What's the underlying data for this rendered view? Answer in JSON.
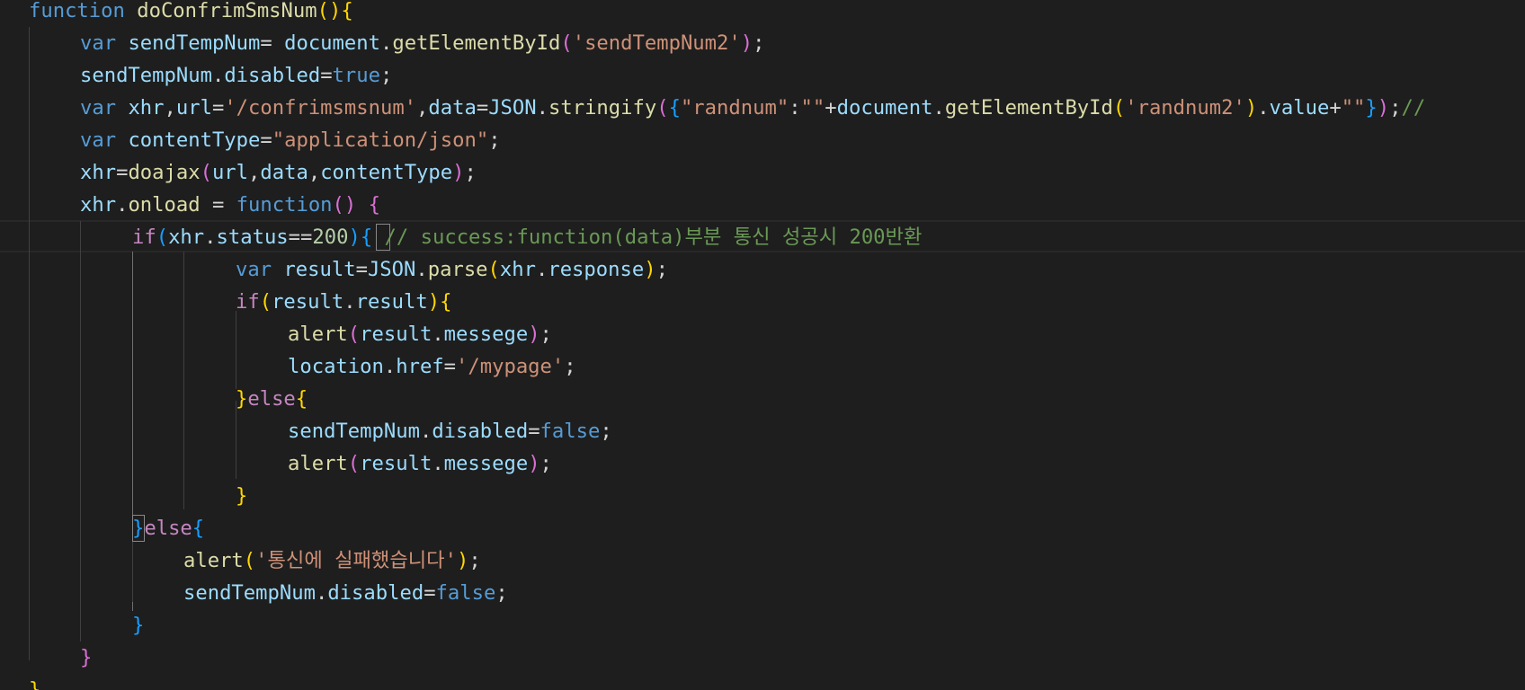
{
  "editor": {
    "language": "javascript",
    "theme_colors": {
      "background": "#1e1e1e",
      "keyword": "#569cd6",
      "control": "#c586c0",
      "function": "#dcdcaa",
      "variable": "#9cdcfe",
      "string": "#ce9178",
      "number": "#b5cea8",
      "comment": "#6a9955",
      "bracket_level_1": "#ffd700",
      "bracket_level_2": "#da70d6",
      "bracket_level_3": "#179fff"
    },
    "lines": [
      {
        "tokens": [
          {
            "t": "function",
            "c": "kw"
          },
          {
            "t": " ",
            "c": "pun"
          },
          {
            "t": "doConfrimSmsNum",
            "c": "fn"
          },
          {
            "t": "()",
            "c": "b1"
          },
          {
            "t": "{",
            "c": "b1"
          }
        ]
      },
      {
        "tokens": [
          {
            "t": "var",
            "c": "kw"
          },
          {
            "t": " ",
            "c": "pun"
          },
          {
            "t": "sendTempNum",
            "c": "var"
          },
          {
            "t": "= ",
            "c": "pun"
          },
          {
            "t": "document",
            "c": "var"
          },
          {
            "t": ".",
            "c": "pun"
          },
          {
            "t": "getElementById",
            "c": "fn"
          },
          {
            "t": "(",
            "c": "b2"
          },
          {
            "t": "'sendTempNum2'",
            "c": "str"
          },
          {
            "t": ")",
            "c": "b2"
          },
          {
            "t": ";",
            "c": "pun"
          }
        ]
      },
      {
        "tokens": [
          {
            "t": "sendTempNum",
            "c": "var"
          },
          {
            "t": ".",
            "c": "pun"
          },
          {
            "t": "disabled",
            "c": "var"
          },
          {
            "t": "=",
            "c": "pun"
          },
          {
            "t": "true",
            "c": "kw"
          },
          {
            "t": ";",
            "c": "pun"
          }
        ]
      },
      {
        "tokens": [
          {
            "t": "var",
            "c": "kw"
          },
          {
            "t": " ",
            "c": "pun"
          },
          {
            "t": "xhr",
            "c": "var"
          },
          {
            "t": ",",
            "c": "pun"
          },
          {
            "t": "url",
            "c": "var"
          },
          {
            "t": "=",
            "c": "pun"
          },
          {
            "t": "'/confrimsmsnum'",
            "c": "str"
          },
          {
            "t": ",",
            "c": "pun"
          },
          {
            "t": "data",
            "c": "var"
          },
          {
            "t": "=",
            "c": "pun"
          },
          {
            "t": "JSON",
            "c": "var"
          },
          {
            "t": ".",
            "c": "pun"
          },
          {
            "t": "stringify",
            "c": "fn"
          },
          {
            "t": "(",
            "c": "b2"
          },
          {
            "t": "{",
            "c": "b3"
          },
          {
            "t": "\"randnum\"",
            "c": "str"
          },
          {
            "t": ":",
            "c": "pun"
          },
          {
            "t": "\"\"",
            "c": "str"
          },
          {
            "t": "+",
            "c": "pun"
          },
          {
            "t": "document",
            "c": "var"
          },
          {
            "t": ".",
            "c": "pun"
          },
          {
            "t": "getElementById",
            "c": "fn"
          },
          {
            "t": "(",
            "c": "b1"
          },
          {
            "t": "'randnum2'",
            "c": "str"
          },
          {
            "t": ")",
            "c": "b1"
          },
          {
            "t": ".",
            "c": "pun"
          },
          {
            "t": "value",
            "c": "var"
          },
          {
            "t": "+",
            "c": "pun"
          },
          {
            "t": "\"\"",
            "c": "str"
          },
          {
            "t": "}",
            "c": "b3"
          },
          {
            "t": ")",
            "c": "b2"
          },
          {
            "t": ";",
            "c": "pun"
          },
          {
            "t": "//",
            "c": "com"
          }
        ]
      },
      {
        "tokens": [
          {
            "t": "var",
            "c": "kw"
          },
          {
            "t": " ",
            "c": "pun"
          },
          {
            "t": "contentType",
            "c": "var"
          },
          {
            "t": "=",
            "c": "pun"
          },
          {
            "t": "\"application/json\"",
            "c": "str"
          },
          {
            "t": ";",
            "c": "pun"
          }
        ]
      },
      {
        "tokens": [
          {
            "t": "xhr",
            "c": "var"
          },
          {
            "t": "=",
            "c": "pun"
          },
          {
            "t": "doajax",
            "c": "fn"
          },
          {
            "t": "(",
            "c": "b2"
          },
          {
            "t": "url",
            "c": "var"
          },
          {
            "t": ",",
            "c": "pun"
          },
          {
            "t": "data",
            "c": "var"
          },
          {
            "t": ",",
            "c": "pun"
          },
          {
            "t": "contentType",
            "c": "var"
          },
          {
            "t": ")",
            "c": "b2"
          },
          {
            "t": ";",
            "c": "pun"
          }
        ]
      },
      {
        "tokens": [
          {
            "t": "xhr",
            "c": "var"
          },
          {
            "t": ".",
            "c": "pun"
          },
          {
            "t": "onload",
            "c": "fn"
          },
          {
            "t": " = ",
            "c": "pun"
          },
          {
            "t": "function",
            "c": "kw"
          },
          {
            "t": "()",
            "c": "b2"
          },
          {
            "t": " ",
            "c": "pun"
          },
          {
            "t": "{",
            "c": "b2"
          }
        ]
      },
      {
        "tokens": [
          {
            "t": "if",
            "c": "ctl"
          },
          {
            "t": "(",
            "c": "b3"
          },
          {
            "t": "xhr",
            "c": "var"
          },
          {
            "t": ".",
            "c": "pun"
          },
          {
            "t": "status",
            "c": "var"
          },
          {
            "t": "==",
            "c": "pun"
          },
          {
            "t": "200",
            "c": "num"
          },
          {
            "t": ")",
            "c": "b3"
          },
          {
            "t": "{",
            "c": "b3"
          },
          {
            "t": " ",
            "c": "pun"
          },
          {
            "t": "// success:function(data)부분 통신 성공시 200반환",
            "c": "com"
          }
        ]
      },
      {
        "tokens": [
          {
            "t": "var",
            "c": "kw"
          },
          {
            "t": " ",
            "c": "pun"
          },
          {
            "t": "result",
            "c": "var"
          },
          {
            "t": "=",
            "c": "pun"
          },
          {
            "t": "JSON",
            "c": "var"
          },
          {
            "t": ".",
            "c": "pun"
          },
          {
            "t": "parse",
            "c": "fn"
          },
          {
            "t": "(",
            "c": "b1"
          },
          {
            "t": "xhr",
            "c": "var"
          },
          {
            "t": ".",
            "c": "pun"
          },
          {
            "t": "response",
            "c": "var"
          },
          {
            "t": ")",
            "c": "b1"
          },
          {
            "t": ";",
            "c": "pun"
          }
        ]
      },
      {
        "tokens": [
          {
            "t": "if",
            "c": "ctl"
          },
          {
            "t": "(",
            "c": "b1"
          },
          {
            "t": "result",
            "c": "var"
          },
          {
            "t": ".",
            "c": "pun"
          },
          {
            "t": "result",
            "c": "var"
          },
          {
            "t": ")",
            "c": "b1"
          },
          {
            "t": "{",
            "c": "b1"
          }
        ]
      },
      {
        "tokens": [
          {
            "t": "alert",
            "c": "fn"
          },
          {
            "t": "(",
            "c": "b2"
          },
          {
            "t": "result",
            "c": "var"
          },
          {
            "t": ".",
            "c": "pun"
          },
          {
            "t": "messege",
            "c": "var"
          },
          {
            "t": ")",
            "c": "b2"
          },
          {
            "t": ";",
            "c": "pun"
          }
        ]
      },
      {
        "tokens": [
          {
            "t": "location",
            "c": "var"
          },
          {
            "t": ".",
            "c": "pun"
          },
          {
            "t": "href",
            "c": "var"
          },
          {
            "t": "=",
            "c": "pun"
          },
          {
            "t": "'/mypage'",
            "c": "str"
          },
          {
            "t": ";",
            "c": "pun"
          }
        ]
      },
      {
        "tokens": [
          {
            "t": "}",
            "c": "b1"
          },
          {
            "t": "else",
            "c": "ctl"
          },
          {
            "t": "{",
            "c": "b1"
          }
        ]
      },
      {
        "tokens": [
          {
            "t": "sendTempNum",
            "c": "var"
          },
          {
            "t": ".",
            "c": "pun"
          },
          {
            "t": "disabled",
            "c": "var"
          },
          {
            "t": "=",
            "c": "pun"
          },
          {
            "t": "false",
            "c": "kw"
          },
          {
            "t": ";",
            "c": "pun"
          }
        ]
      },
      {
        "tokens": [
          {
            "t": "alert",
            "c": "fn"
          },
          {
            "t": "(",
            "c": "b2"
          },
          {
            "t": "result",
            "c": "var"
          },
          {
            "t": ".",
            "c": "pun"
          },
          {
            "t": "messege",
            "c": "var"
          },
          {
            "t": ")",
            "c": "b2"
          },
          {
            "t": ";",
            "c": "pun"
          }
        ]
      },
      {
        "tokens": [
          {
            "t": "}",
            "c": "b1"
          }
        ]
      },
      {
        "tokens": [
          {
            "t": "}",
            "c": "b3"
          },
          {
            "t": "else",
            "c": "ctl"
          },
          {
            "t": "{",
            "c": "b3"
          }
        ]
      },
      {
        "tokens": [
          {
            "t": "alert",
            "c": "fn"
          },
          {
            "t": "(",
            "c": "b1"
          },
          {
            "t": "'통신에 실패했습니다'",
            "c": "str"
          },
          {
            "t": ")",
            "c": "b1"
          },
          {
            "t": ";",
            "c": "pun"
          }
        ]
      },
      {
        "tokens": [
          {
            "t": "sendTempNum",
            "c": "var"
          },
          {
            "t": ".",
            "c": "pun"
          },
          {
            "t": "disabled",
            "c": "var"
          },
          {
            "t": "=",
            "c": "pun"
          },
          {
            "t": "false",
            "c": "kw"
          },
          {
            "t": ";",
            "c": "pun"
          }
        ]
      },
      {
        "tokens": [
          {
            "t": "}",
            "c": "b3"
          }
        ]
      },
      {
        "tokens": [
          {
            "t": "}",
            "c": "b2"
          }
        ]
      },
      {
        "tokens": [
          {
            "t": "}",
            "c": "b1"
          }
        ]
      }
    ]
  }
}
